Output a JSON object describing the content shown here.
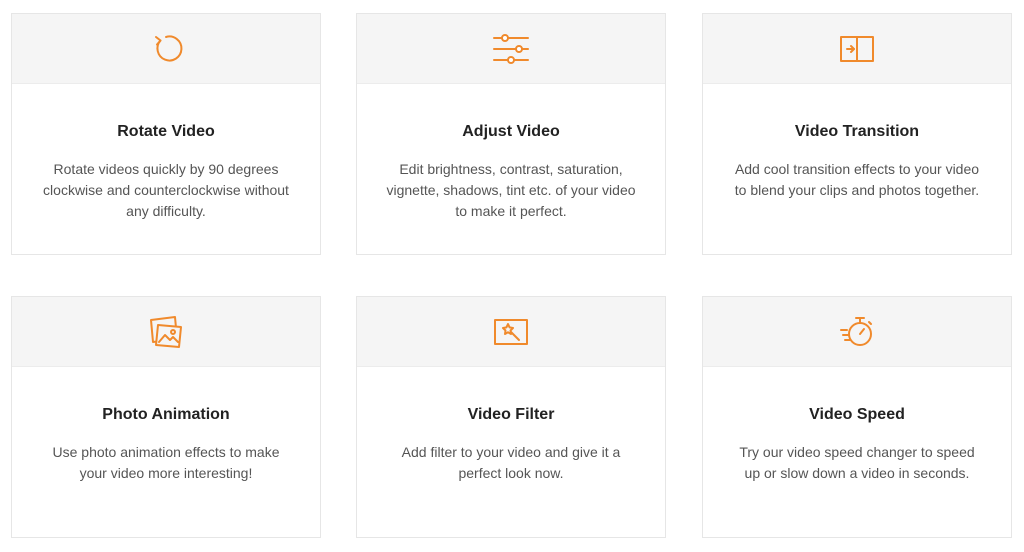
{
  "accent_color": "#f08a2c",
  "features": [
    {
      "icon": "rotate-icon",
      "title": "Rotate Video",
      "description": "Rotate videos quickly by 90 degrees clockwise and counterclockwise without any difficulty."
    },
    {
      "icon": "sliders-icon",
      "title": "Adjust Video",
      "description": "Edit brightness, contrast, saturation, vignette, shadows, tint etc. of your video to make it perfect."
    },
    {
      "icon": "transition-icon",
      "title": "Video Transition",
      "description": "Add cool transition effects to your video to blend your clips and photos together."
    },
    {
      "icon": "photo-animation-icon",
      "title": "Photo Animation",
      "description": "Use photo animation effects to make your video more interesting!"
    },
    {
      "icon": "magic-filter-icon",
      "title": "Video Filter",
      "description": "Add filter to your video and give it a perfect look now."
    },
    {
      "icon": "stopwatch-speed-icon",
      "title": "Video Speed",
      "description": "Try our video speed changer to speed up or slow down a video in seconds."
    }
  ]
}
